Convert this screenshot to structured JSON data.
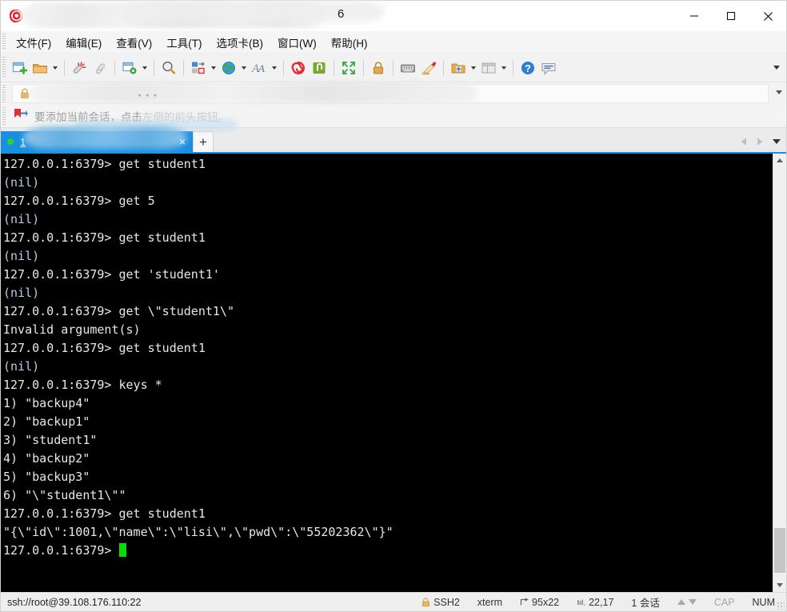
{
  "window": {
    "title_number": "6",
    "controls": {
      "minimize": "minimize-button",
      "maximize": "maximize-button",
      "close": "close-button"
    }
  },
  "menubar": {
    "items": [
      {
        "label": "文件(F)",
        "name": "menu-file"
      },
      {
        "label": "编辑(E)",
        "name": "menu-edit"
      },
      {
        "label": "查看(V)",
        "name": "menu-view"
      },
      {
        "label": "工具(T)",
        "name": "menu-tools"
      },
      {
        "label": "选项卡(B)",
        "name": "menu-tabs"
      },
      {
        "label": "窗口(W)",
        "name": "menu-window"
      },
      {
        "label": "帮助(H)",
        "name": "menu-help"
      }
    ]
  },
  "toolbar": {
    "icons": [
      "new-session-icon",
      "open-folder-icon",
      "disconnect-icon",
      "link-icon",
      "session-options-icon",
      "search-icon",
      "transfer-icon",
      "globe-icon",
      "font-icon",
      "spiral-icon",
      "green-app-icon",
      "fullscreen-icon",
      "lock-icon",
      "keyboard-icon",
      "highlight-pen-icon",
      "add-folder-icon",
      "layout-icon",
      "help-icon",
      "chat-icon"
    ],
    "overflow": "toolbar-overflow-icon"
  },
  "addressbar": {
    "lock": "lock-icon",
    "value": "",
    "placeholder": "",
    "dots": "▪ ▪ ▪",
    "dropdown": "address-dropdown-icon"
  },
  "notice": {
    "icon": "bookmark-flag-icon",
    "text": "要添加当前会话，点击左侧的前头按钮。"
  },
  "tabs": {
    "active_index": 0,
    "items": [
      {
        "label": "1",
        "name": "terminal-tab-1",
        "status": "connected"
      }
    ],
    "new_tab_label": "+",
    "close_label": "×"
  },
  "terminal": {
    "prompt": "127.0.0.1:6379>",
    "lines": [
      {
        "type": "prompt",
        "cmd": " get student1"
      },
      {
        "type": "nil",
        "text": "(nil)"
      },
      {
        "type": "prompt",
        "cmd": " get 5"
      },
      {
        "type": "nil",
        "text": "(nil)"
      },
      {
        "type": "prompt",
        "cmd": " get student1"
      },
      {
        "type": "nil",
        "text": "(nil)"
      },
      {
        "type": "prompt",
        "cmd": " get 'student1'"
      },
      {
        "type": "nil",
        "text": "(nil)"
      },
      {
        "type": "prompt",
        "cmd": " get \\\"student1\\\""
      },
      {
        "type": "err",
        "text": "Invalid argument(s)"
      },
      {
        "type": "prompt",
        "cmd": " get student1"
      },
      {
        "type": "nil",
        "text": "(nil)"
      },
      {
        "type": "prompt",
        "cmd": " keys *"
      },
      {
        "type": "out",
        "text": "1) \"backup4\""
      },
      {
        "type": "out",
        "text": "2) \"backup1\""
      },
      {
        "type": "out",
        "text": "3) \"student1\""
      },
      {
        "type": "out",
        "text": "4) \"backup2\""
      },
      {
        "type": "out",
        "text": "5) \"backup3\""
      },
      {
        "type": "out",
        "text": "6) \"\\\"student1\\\"\""
      },
      {
        "type": "prompt",
        "cmd": " get student1"
      },
      {
        "type": "out",
        "text": "\"{\\\"id\\\":1001,\\\"name\\\":\\\"lisi\\\",\\\"pwd\\\":\\\"55202362\\\"}\""
      },
      {
        "type": "cursor",
        "cmd": " "
      }
    ]
  },
  "statusbar": {
    "connection": "ssh://root@39.108.176.110:22",
    "protocol": "SSH2",
    "emulation": "xterm",
    "size": "95x22",
    "cursor_pos": "22,17",
    "sessions": "1 会话",
    "caps": "CAP",
    "num": "NUM"
  },
  "colors": {
    "accent": "#1a8fe0",
    "terminal_bg": "#000000",
    "terminal_fg": "#e6e6e6",
    "nil_fg": "#b8cfe8",
    "cursor": "#00e000",
    "connected_dot": "#2dd42d"
  }
}
